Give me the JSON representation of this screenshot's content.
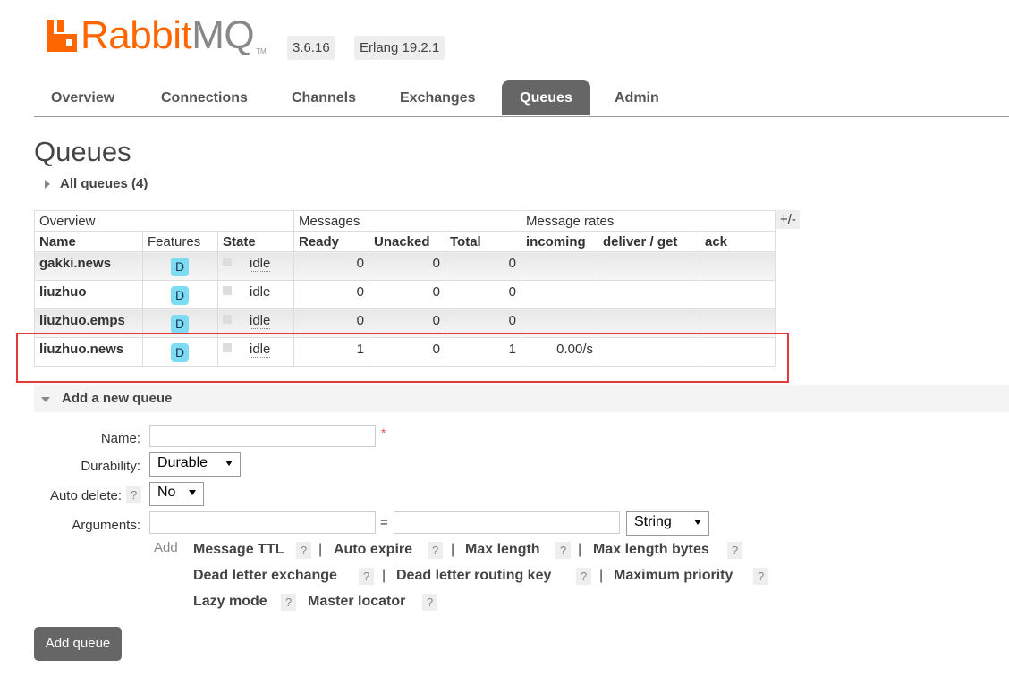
{
  "header": {
    "brand_rabbit": "Rabbit",
    "brand_mq": "MQ",
    "tm": "TM",
    "version": "3.6.16",
    "erlang": "Erlang 19.2.1"
  },
  "nav": {
    "tabs": [
      "Overview",
      "Connections",
      "Channels",
      "Exchanges",
      "Queues",
      "Admin"
    ],
    "active": "Queues"
  },
  "page": {
    "title": "Queues",
    "all_queues": "All queues (4)"
  },
  "table": {
    "group_headers": [
      "Overview",
      "Messages",
      "Message rates"
    ],
    "columns": [
      "Name",
      "Features",
      "State",
      "Ready",
      "Unacked",
      "Total",
      "incoming",
      "deliver / get",
      "ack"
    ],
    "toggle_columns": "+/-",
    "rows": [
      {
        "name": "gakki.news",
        "feature": "D",
        "state": "idle",
        "ready": "0",
        "unacked": "0",
        "total": "0",
        "incoming": "",
        "deliver": "",
        "ack": ""
      },
      {
        "name": "liuzhuo",
        "feature": "D",
        "state": "idle",
        "ready": "0",
        "unacked": "0",
        "total": "0",
        "incoming": "",
        "deliver": "",
        "ack": ""
      },
      {
        "name": "liuzhuo.emps",
        "feature": "D",
        "state": "idle",
        "ready": "0",
        "unacked": "0",
        "total": "0",
        "incoming": "",
        "deliver": "",
        "ack": ""
      },
      {
        "name": "liuzhuo.news",
        "feature": "D",
        "state": "idle",
        "ready": "1",
        "unacked": "0",
        "total": "1",
        "incoming": "0.00/s",
        "deliver": "",
        "ack": ""
      }
    ]
  },
  "add_queue": {
    "section_title": "Add a new queue",
    "name_label": "Name:",
    "required_mark": "*",
    "durability_label": "Durability:",
    "durability_value": "Durable",
    "auto_delete_label": "Auto delete:",
    "auto_delete_value": "No",
    "arguments_label": "Arguments:",
    "equals": "=",
    "arg_type_value": "String",
    "add_label": "Add",
    "help": "?",
    "arg_links_row1": [
      "Message TTL",
      "Auto expire",
      "Max length",
      "Max length bytes"
    ],
    "arg_links_row2": [
      "Dead letter exchange",
      "Dead letter routing key",
      "Maximum priority"
    ],
    "arg_links_row3": [
      "Lazy mode",
      "Master locator"
    ],
    "separator": "|",
    "submit": "Add queue"
  },
  "colors": {
    "brand": "#ff6600",
    "highlight": "#e53935",
    "badge": "#7cdcf1"
  }
}
